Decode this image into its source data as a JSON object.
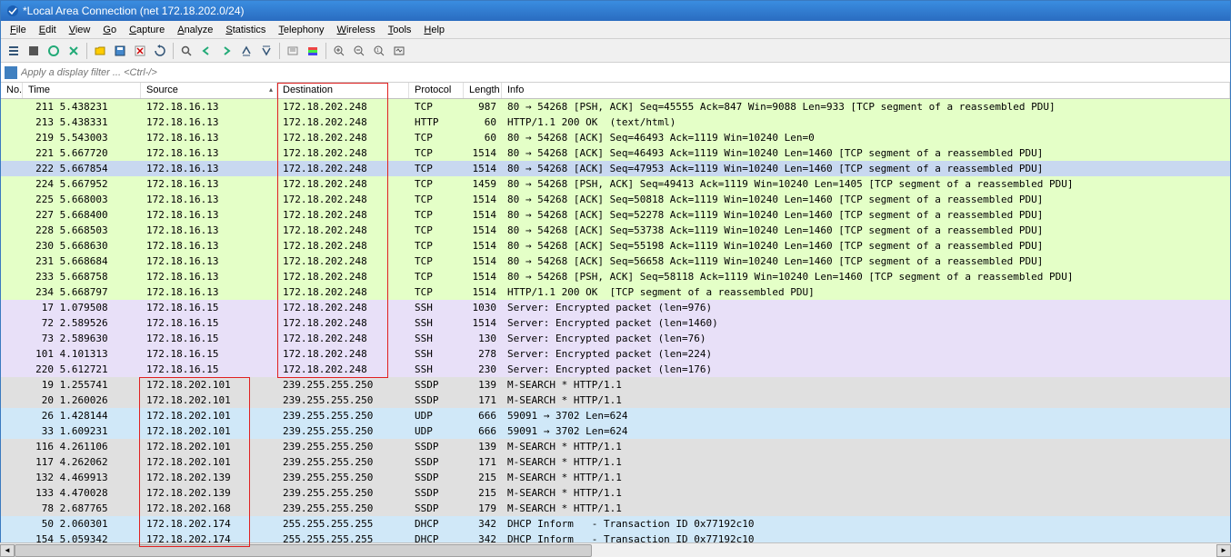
{
  "title": "*Local Area Connection (net 172.18.202.0/24)",
  "menus": [
    "File",
    "Edit",
    "View",
    "Go",
    "Capture",
    "Analyze",
    "Statistics",
    "Telephony",
    "Wireless",
    "Tools",
    "Help"
  ],
  "filter_placeholder": "Apply a display filter ... <Ctrl-/>",
  "columns": {
    "no": "No.",
    "time": "Time",
    "source": "Source",
    "destination": "Destination",
    "protocol": "Protocol",
    "length": "Length",
    "info": "Info"
  },
  "rows": [
    {
      "no": "211",
      "time": "5.438231",
      "src": "172.18.16.13",
      "dst": "172.18.202.248",
      "proto": "TCP",
      "len": "987",
      "info": "80 → 54268 [PSH, ACK] Seq=45555 Ack=847 Win=9088 Len=933 [TCP segment of a reassembled PDU]",
      "bg": "green"
    },
    {
      "no": "213",
      "time": "5.438331",
      "src": "172.18.16.13",
      "dst": "172.18.202.248",
      "proto": "HTTP",
      "len": "60",
      "info": "HTTP/1.1 200 OK  (text/html)",
      "bg": "green"
    },
    {
      "no": "219",
      "time": "5.543003",
      "src": "172.18.16.13",
      "dst": "172.18.202.248",
      "proto": "TCP",
      "len": "60",
      "info": "80 → 54268 [ACK] Seq=46493 Ack=1119 Win=10240 Len=0",
      "bg": "green"
    },
    {
      "no": "221",
      "time": "5.667720",
      "src": "172.18.16.13",
      "dst": "172.18.202.248",
      "proto": "TCP",
      "len": "1514",
      "info": "80 → 54268 [ACK] Seq=46493 Ack=1119 Win=10240 Len=1460 [TCP segment of a reassembled PDU]",
      "bg": "green"
    },
    {
      "no": "222",
      "time": "5.667854",
      "src": "172.18.16.13",
      "dst": "172.18.202.248",
      "proto": "TCP",
      "len": "1514",
      "info": "80 → 54268 [ACK] Seq=47953 Ack=1119 Win=10240 Len=1460 [TCP segment of a reassembled PDU]",
      "bg": "sel"
    },
    {
      "no": "224",
      "time": "5.667952",
      "src": "172.18.16.13",
      "dst": "172.18.202.248",
      "proto": "TCP",
      "len": "1459",
      "info": "80 → 54268 [PSH, ACK] Seq=49413 Ack=1119 Win=10240 Len=1405 [TCP segment of a reassembled PDU]",
      "bg": "green"
    },
    {
      "no": "225",
      "time": "5.668003",
      "src": "172.18.16.13",
      "dst": "172.18.202.248",
      "proto": "TCP",
      "len": "1514",
      "info": "80 → 54268 [ACK] Seq=50818 Ack=1119 Win=10240 Len=1460 [TCP segment of a reassembled PDU]",
      "bg": "green"
    },
    {
      "no": "227",
      "time": "5.668400",
      "src": "172.18.16.13",
      "dst": "172.18.202.248",
      "proto": "TCP",
      "len": "1514",
      "info": "80 → 54268 [ACK] Seq=52278 Ack=1119 Win=10240 Len=1460 [TCP segment of a reassembled PDU]",
      "bg": "green"
    },
    {
      "no": "228",
      "time": "5.668503",
      "src": "172.18.16.13",
      "dst": "172.18.202.248",
      "proto": "TCP",
      "len": "1514",
      "info": "80 → 54268 [ACK] Seq=53738 Ack=1119 Win=10240 Len=1460 [TCP segment of a reassembled PDU]",
      "bg": "green"
    },
    {
      "no": "230",
      "time": "5.668630",
      "src": "172.18.16.13",
      "dst": "172.18.202.248",
      "proto": "TCP",
      "len": "1514",
      "info": "80 → 54268 [ACK] Seq=55198 Ack=1119 Win=10240 Len=1460 [TCP segment of a reassembled PDU]",
      "bg": "green"
    },
    {
      "no": "231",
      "time": "5.668684",
      "src": "172.18.16.13",
      "dst": "172.18.202.248",
      "proto": "TCP",
      "len": "1514",
      "info": "80 → 54268 [ACK] Seq=56658 Ack=1119 Win=10240 Len=1460 [TCP segment of a reassembled PDU]",
      "bg": "green"
    },
    {
      "no": "233",
      "time": "5.668758",
      "src": "172.18.16.13",
      "dst": "172.18.202.248",
      "proto": "TCP",
      "len": "1514",
      "info": "80 → 54268 [PSH, ACK] Seq=58118 Ack=1119 Win=10240 Len=1460 [TCP segment of a reassembled PDU]",
      "bg": "green"
    },
    {
      "no": "234",
      "time": "5.668797",
      "src": "172.18.16.13",
      "dst": "172.18.202.248",
      "proto": "TCP",
      "len": "1514",
      "info": "HTTP/1.1 200 OK  [TCP segment of a reassembled PDU]",
      "bg": "green"
    },
    {
      "no": "17",
      "time": "1.079508",
      "src": "172.18.16.15",
      "dst": "172.18.202.248",
      "proto": "SSH",
      "len": "1030",
      "info": "Server: Encrypted packet (len=976)",
      "bg": "lav"
    },
    {
      "no": "72",
      "time": "2.589526",
      "src": "172.18.16.15",
      "dst": "172.18.202.248",
      "proto": "SSH",
      "len": "1514",
      "info": "Server: Encrypted packet (len=1460)",
      "bg": "lav"
    },
    {
      "no": "73",
      "time": "2.589630",
      "src": "172.18.16.15",
      "dst": "172.18.202.248",
      "proto": "SSH",
      "len": "130",
      "info": "Server: Encrypted packet (len=76)",
      "bg": "lav"
    },
    {
      "no": "101",
      "time": "4.101313",
      "src": "172.18.16.15",
      "dst": "172.18.202.248",
      "proto": "SSH",
      "len": "278",
      "info": "Server: Encrypted packet (len=224)",
      "bg": "lav"
    },
    {
      "no": "220",
      "time": "5.612721",
      "src": "172.18.16.15",
      "dst": "172.18.202.248",
      "proto": "SSH",
      "len": "230",
      "info": "Server: Encrypted packet (len=176)",
      "bg": "lav"
    },
    {
      "no": "19",
      "time": "1.255741",
      "src": "172.18.202.101",
      "dst": "239.255.255.250",
      "proto": "SSDP",
      "len": "139",
      "info": "M-SEARCH * HTTP/1.1",
      "bg": "gray"
    },
    {
      "no": "20",
      "time": "1.260026",
      "src": "172.18.202.101",
      "dst": "239.255.255.250",
      "proto": "SSDP",
      "len": "171",
      "info": "M-SEARCH * HTTP/1.1",
      "bg": "gray"
    },
    {
      "no": "26",
      "time": "1.428144",
      "src": "172.18.202.101",
      "dst": "239.255.255.250",
      "proto": "UDP",
      "len": "666",
      "info": "59091 → 3702 Len=624",
      "bg": "cyan"
    },
    {
      "no": "33",
      "time": "1.609231",
      "src": "172.18.202.101",
      "dst": "239.255.255.250",
      "proto": "UDP",
      "len": "666",
      "info": "59091 → 3702 Len=624",
      "bg": "cyan"
    },
    {
      "no": "116",
      "time": "4.261106",
      "src": "172.18.202.101",
      "dst": "239.255.255.250",
      "proto": "SSDP",
      "len": "139",
      "info": "M-SEARCH * HTTP/1.1",
      "bg": "gray"
    },
    {
      "no": "117",
      "time": "4.262062",
      "src": "172.18.202.101",
      "dst": "239.255.255.250",
      "proto": "SSDP",
      "len": "171",
      "info": "M-SEARCH * HTTP/1.1",
      "bg": "gray"
    },
    {
      "no": "132",
      "time": "4.469913",
      "src": "172.18.202.139",
      "dst": "239.255.255.250",
      "proto": "SSDP",
      "len": "215",
      "info": "M-SEARCH * HTTP/1.1",
      "bg": "gray"
    },
    {
      "no": "133",
      "time": "4.470028",
      "src": "172.18.202.139",
      "dst": "239.255.255.250",
      "proto": "SSDP",
      "len": "215",
      "info": "M-SEARCH * HTTP/1.1",
      "bg": "gray"
    },
    {
      "no": "78",
      "time": "2.687765",
      "src": "172.18.202.168",
      "dst": "239.255.255.250",
      "proto": "SSDP",
      "len": "179",
      "info": "M-SEARCH * HTTP/1.1",
      "bg": "gray"
    },
    {
      "no": "50",
      "time": "2.060301",
      "src": "172.18.202.174",
      "dst": "255.255.255.255",
      "proto": "DHCP",
      "len": "342",
      "info": "DHCP Inform   - Transaction ID 0x77192c10",
      "bg": "cyan"
    },
    {
      "no": "154",
      "time": "5.059342",
      "src": "172.18.202.174",
      "dst": "255.255.255.255",
      "proto": "DHCP",
      "len": "342",
      "info": "DHCP Inform   - Transaction ID 0x77192c10",
      "bg": "cyan"
    }
  ],
  "toolbar_icons": [
    "list",
    "stop",
    "circle",
    "cross",
    "file",
    "save",
    "close",
    "reload",
    "find",
    "back-arrow",
    "fwd-arrow",
    "jump",
    "end",
    "nocol",
    "col",
    "zoom-in",
    "zoom-out",
    "zoom-fit",
    "zoom-reset"
  ]
}
